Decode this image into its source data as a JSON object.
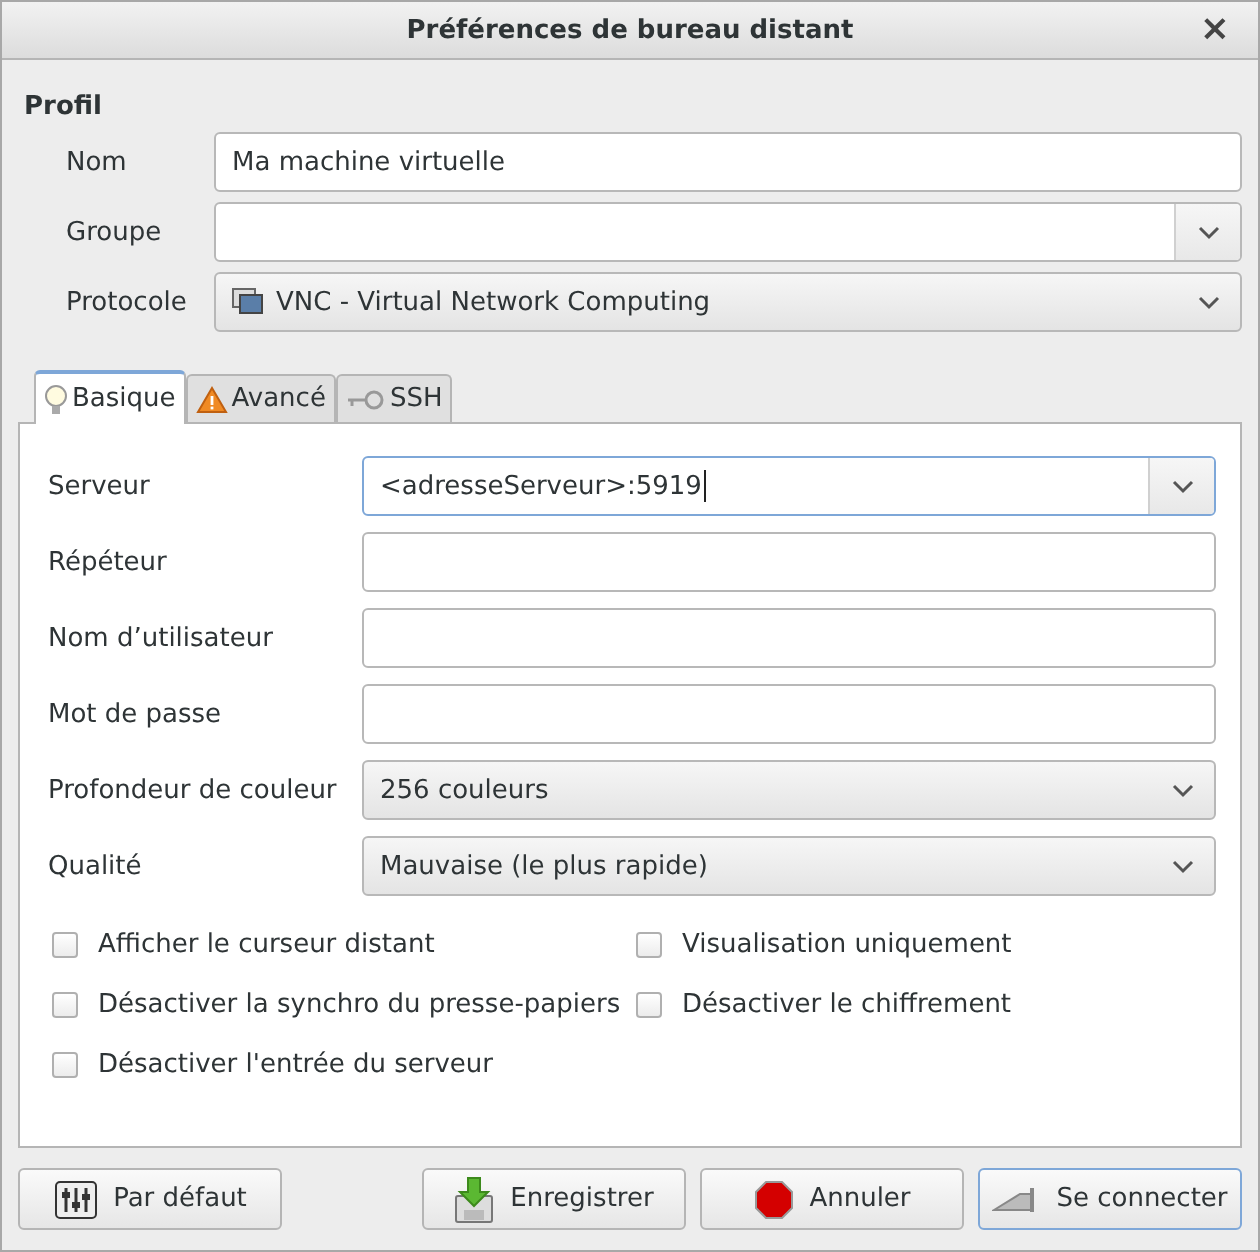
{
  "window": {
    "title": "Préférences de bureau distant",
    "close": "×"
  },
  "profile": {
    "heading": "Profil",
    "fields": [
      {
        "label": "Nom",
        "kind": "entry",
        "value": "Ma machine virtuelle"
      },
      {
        "label": "Groupe",
        "kind": "combo"
      },
      {
        "label": "Protocole",
        "kind": "select",
        "value": "VNC - Virtual Network Computing"
      }
    ]
  },
  "tabs": [
    {
      "label": "Basique",
      "selected": true
    },
    {
      "label": "Avancé",
      "selected": false
    },
    {
      "label": "SSH",
      "selected": false
    }
  ],
  "basic": {
    "fields": [
      {
        "label": "Serveur",
        "kind": "combo",
        "value": "<adresseServeur>:5919",
        "focused": true
      },
      {
        "label": "Répéteur",
        "kind": "entry"
      },
      {
        "label": "Nom d’utilisateur",
        "kind": "entry"
      },
      {
        "label": "Mot de passe",
        "kind": "entry"
      },
      {
        "label": "Profondeur de couleur",
        "kind": "select",
        "value": "256 couleurs"
      },
      {
        "label": "Qualité",
        "kind": "select",
        "value": "Mauvaise (le plus rapide)"
      }
    ],
    "checkboxes": [
      {
        "label": "Afficher le curseur distant",
        "checked": false
      },
      {
        "label": "Visualisation uniquement",
        "checked": false
      },
      {
        "label": "Désactiver la synchro du presse-papiers",
        "checked": false
      },
      {
        "label": "Désactiver le chiffrement",
        "checked": false
      },
      {
        "label": "Désactiver l'entrée du serveur",
        "checked": false
      }
    ]
  },
  "buttons": [
    {
      "label": "Par défaut",
      "default": false
    },
    {
      "label": "Enregistrer",
      "default": false
    },
    {
      "label": "Annuler",
      "default": false
    },
    {
      "label": "Se connecter",
      "default": true
    }
  ]
}
